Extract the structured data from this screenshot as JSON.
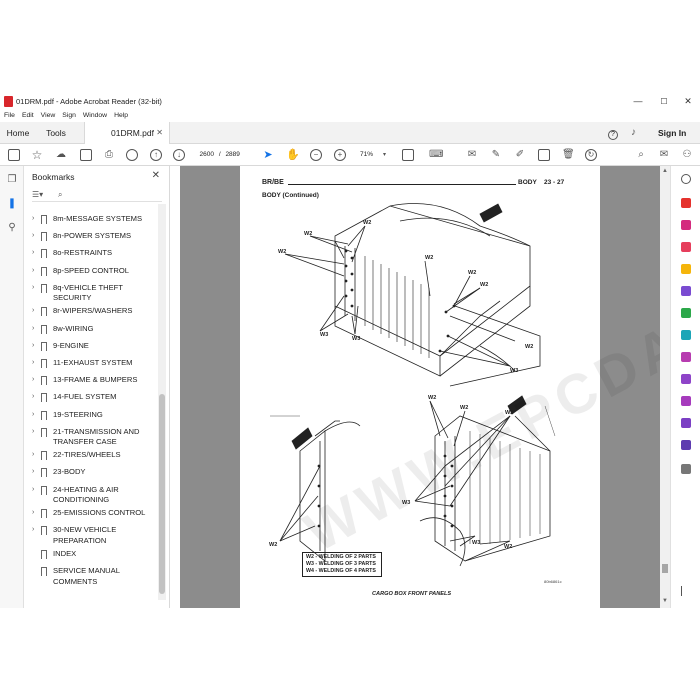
{
  "window": {
    "title": "01DRM.pdf - Adobe Acrobat Reader (32-bit)",
    "controls": [
      "—",
      "☐",
      "✕"
    ]
  },
  "menu": [
    "File",
    "Edit",
    "View",
    "Sign",
    "Window",
    "Help"
  ],
  "tabs": {
    "home": "Home",
    "tools": "Tools",
    "document": "01DRM.pdf",
    "close": "✕"
  },
  "account": {
    "help": "?",
    "sign_in": "Sign In"
  },
  "toolbar": {
    "current_page": "2600",
    "separator": "/",
    "total_pages": "2889",
    "zoom": "71%"
  },
  "bookmarks": {
    "title": "Bookmarks",
    "close": "✕",
    "items": [
      "8m-MESSAGE SYSTEMS",
      "8n-POWER SYSTEMS",
      "8o-RESTRAINTS",
      "8p-SPEED CONTROL",
      "8q-VEHICLE THEFT SECURITY",
      "8r-WIPERS/WASHERS",
      "8w-WIRING",
      "9-ENGINE",
      "11-EXHAUST SYSTEM",
      "13-FRAME & BUMPERS",
      "14-FUEL SYSTEM",
      "19-STEERING",
      "21-TRANSMISSION AND TRANSFER CASE",
      "22-TIRES/WHEELS",
      "23-BODY",
      "24-HEATING & AIR CONDITIONING",
      "25-EMISSIONS CONTROL",
      "30-NEW VEHICLE PREPARATION",
      "INDEX",
      "SERVICE MANUAL COMMENTS"
    ]
  },
  "page": {
    "header_left": "BR/BE",
    "header_section": "BODY",
    "header_page": "23 - 27",
    "subheader": "BODY (Continued)",
    "legend": [
      "W2 - WELDING OF 2 PARTS",
      "W3 - WELDING OF 3 PARTS",
      "W4 - WELDING OF 4 PARTS"
    ],
    "caption": "CARGO BOX FRONT PANELS",
    "figure_id": "80b6861c",
    "callouts": {
      "w2": "W2",
      "w3": "W3"
    },
    "watermark": "WWW.EPCDATA.COM"
  },
  "colors": {
    "accent": "#1473e6",
    "pdf_red": "#d8262b",
    "canvas_gray": "#8c8c8c"
  }
}
